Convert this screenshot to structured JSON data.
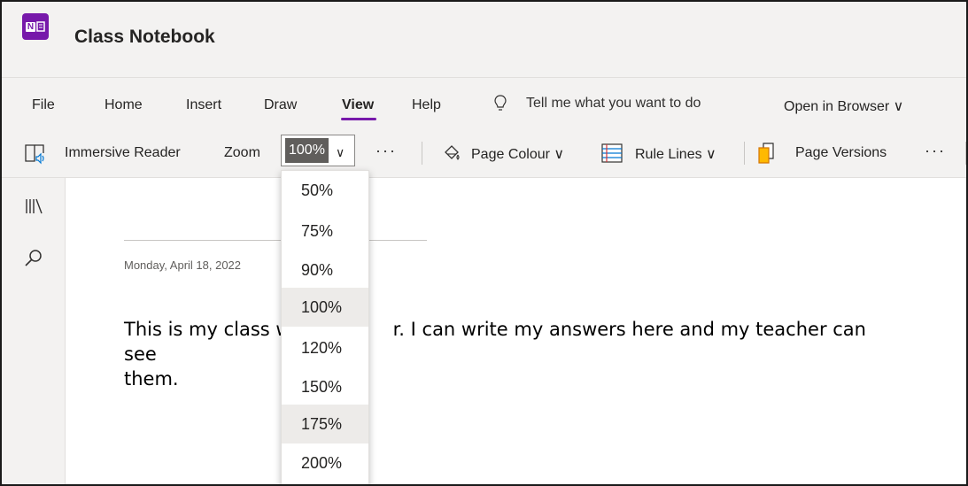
{
  "app": {
    "title": "Class Notebook",
    "logo_text": "N"
  },
  "menu": {
    "tabs": [
      "File",
      "Home",
      "Insert",
      "Draw",
      "View",
      "Help"
    ],
    "active_tab": "View",
    "tell_me": "Tell me what you want to do",
    "open_in_browser": "Open in Browser ∨"
  },
  "toolbar": {
    "immersive_reader": "Immersive Reader",
    "zoom_label": "Zoom",
    "zoom_value": "100%",
    "page_colour": "Page Colour ∨",
    "rule_lines": "Rule Lines ∨",
    "page_versions": "Page Versions",
    "more": "···"
  },
  "zoom_options": [
    "50%",
    "75%",
    "90%",
    "100%",
    "120%",
    "150%",
    "175%",
    "200%"
  ],
  "zoom_selected": "100%",
  "zoom_hover": "175%",
  "page": {
    "date": "Monday, April 18, 2022",
    "body_line1_start": "This is my class w",
    "body_line1_end": "r. I can write my answers here and my teacher can see",
    "body_line2": "them."
  },
  "colors": {
    "accent": "#7719aa",
    "ribbon": "#f3f2f1"
  },
  "icons": [
    "immersive-reader-icon",
    "page-colour-icon",
    "rule-lines-icon",
    "page-versions-icon",
    "library-icon",
    "search-icon",
    "lightbulb-icon",
    "chevron-down-icon"
  ]
}
